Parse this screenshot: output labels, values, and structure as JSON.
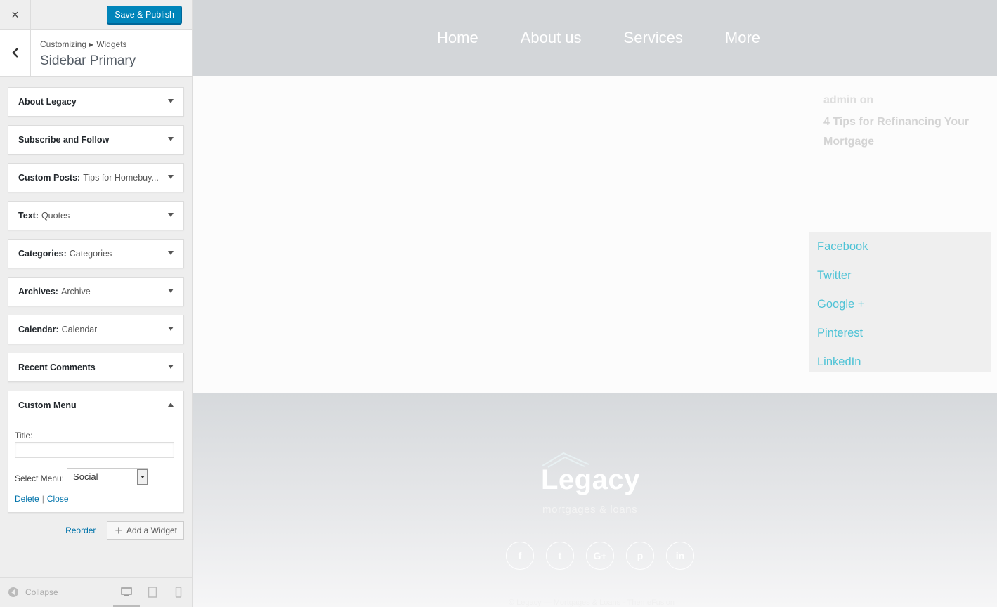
{
  "customizer": {
    "close_label": "×",
    "save_label": "Save & Publish",
    "breadcrumb": {
      "root": "Customizing",
      "section": "Widgets"
    },
    "section_title": "Sidebar Primary",
    "widgets": [
      {
        "name": "About Legacy",
        "sub": ""
      },
      {
        "name": "Subscribe and Follow",
        "sub": ""
      },
      {
        "name": "Custom Posts:",
        "sub": "Tips for Homebuy..."
      },
      {
        "name": "Text:",
        "sub": "Quotes"
      },
      {
        "name": "Categories:",
        "sub": "Categories"
      },
      {
        "name": "Archives:",
        "sub": "Archive"
      },
      {
        "name": "Calendar:",
        "sub": "Calendar"
      },
      {
        "name": "Recent Comments",
        "sub": ""
      }
    ],
    "open_widget": {
      "name": "Custom Menu",
      "title_label": "Title:",
      "title_value": "",
      "select_label": "Select Menu:",
      "select_value": "Social",
      "delete_label": "Delete",
      "separator": "|",
      "close_label": "Close"
    },
    "reorder_label": "Reorder",
    "add_widget_label": "Add a Widget",
    "collapse_label": "Collapse"
  },
  "preview": {
    "nav": [
      "Home",
      "About us",
      "Services",
      "More"
    ],
    "recent_comment": {
      "author": "admin on",
      "post": "4 Tips for Refinancing Your Mortgage"
    },
    "social_menu": [
      "Facebook",
      "Twitter",
      "Google +",
      "Pinterest",
      "LinkedIn"
    ],
    "logo": {
      "name": "Legacy",
      "tagline": "mortgages & loans"
    },
    "footer_socials": [
      "f",
      "t",
      "G+",
      "p",
      "in"
    ],
    "copyright": "© Legacy — Mortgages & Loans · ThemeFusion"
  },
  "colors": {
    "accent": "#0085ba",
    "link": "#0073aa",
    "social_link": "#4fc3d6",
    "header_bg": "#d3d6d9"
  }
}
